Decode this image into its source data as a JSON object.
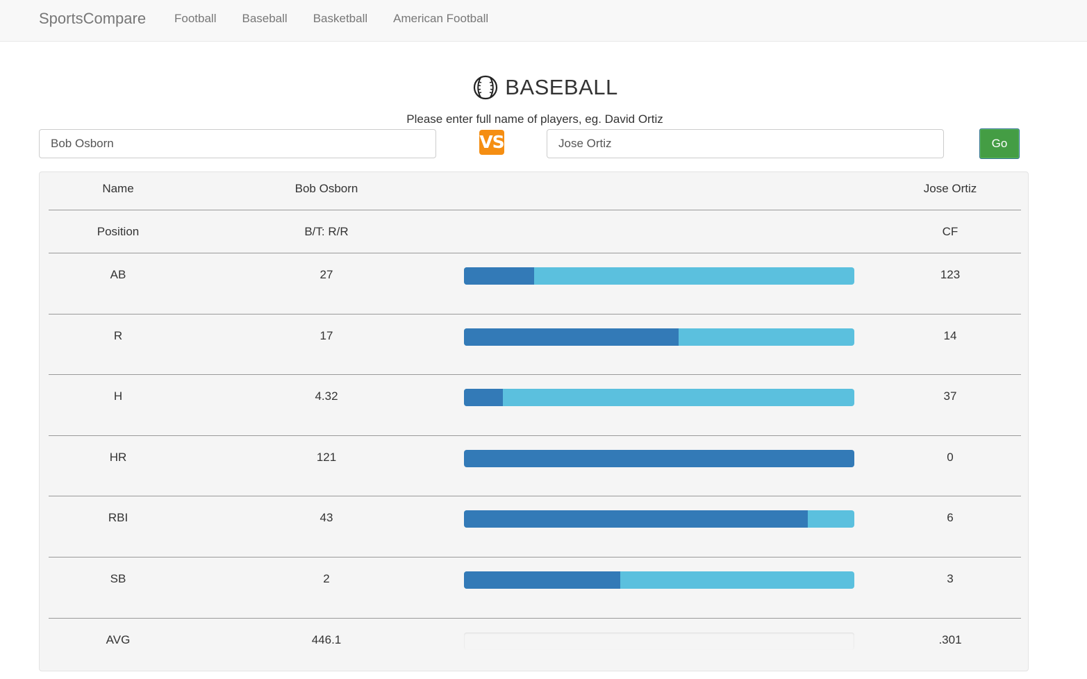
{
  "nav": {
    "brand": "SportsCompare",
    "links": [
      "Football",
      "Baseball",
      "Basketball",
      "American Football"
    ]
  },
  "header": {
    "icon": "baseball-icon",
    "title": "BASEBALL",
    "hint": "Please enter full name of players, eg. David Ortiz"
  },
  "search": {
    "player1_value": "Bob Osborn",
    "player2_value": "Jose Ortiz",
    "vs_label": "VS",
    "go_label": "Go"
  },
  "colors": {
    "player1_bar": "#337ab7",
    "player2_bar": "#5bc0de",
    "go_button": "#449d44",
    "vs_badge": "#f58e12"
  },
  "table": {
    "header": {
      "label": "Name",
      "p1": "Bob Osborn",
      "p2": "Jose Ortiz"
    },
    "position": {
      "label": "Position",
      "p1": "B/T: R/R",
      "p2": "CF"
    },
    "stats": [
      {
        "label": "AB",
        "p1": "27",
        "p2": "123",
        "p1_share": 0.18
      },
      {
        "label": "R",
        "p1": "17",
        "p2": "14",
        "p1_share": 0.55
      },
      {
        "label": "H",
        "p1": "4.32",
        "p2": "37",
        "p1_share": 0.1
      },
      {
        "label": "HR",
        "p1": "121",
        "p2": "0",
        "p1_share": 1.0
      },
      {
        "label": "RBI",
        "p1": "43",
        "p2": "6",
        "p1_share": 0.88
      },
      {
        "label": "SB",
        "p1": "2",
        "p2": "3",
        "p1_share": 0.4
      },
      {
        "label": "AVG",
        "p1": "446.1",
        "p2": ".301",
        "p1_share": null
      }
    ]
  }
}
